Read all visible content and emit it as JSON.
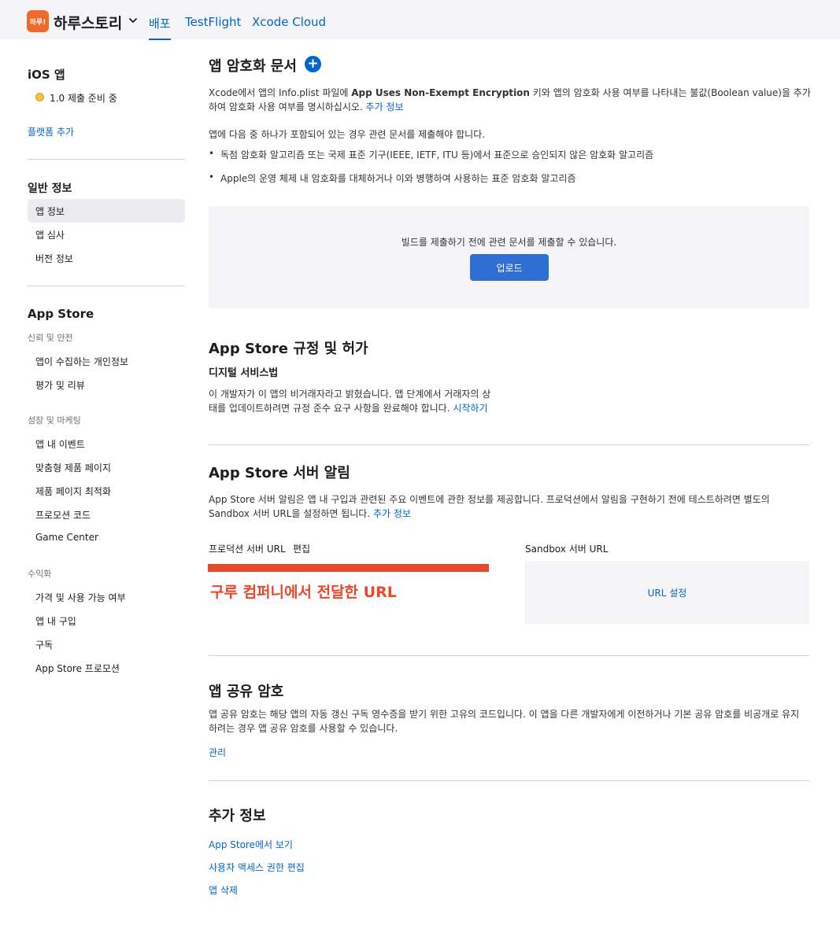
{
  "topbar": {
    "app_icon_text": "하루!",
    "app_name": "하루스토리",
    "tabs": [
      {
        "label": "배포",
        "active": true
      },
      {
        "label": "TestFlight",
        "active": false
      },
      {
        "label": "Xcode Cloud",
        "active": false
      }
    ],
    "accent_color": "#0066cc"
  },
  "sidebar": {
    "platform_title": "iOS 앱",
    "version_status": "1.0 제출 준비 중",
    "add_platform": "플랫폼 추가",
    "general_title": "일반 정보",
    "general_items": [
      "앱 정보",
      "앱 심사",
      "버전 정보"
    ],
    "store_title": "App Store",
    "trust_sub": "신뢰 및 안전",
    "trust_items": [
      "앱이 수집하는 개인정보",
      "평가 및 리뷰"
    ],
    "growth_sub": "성장 및 마케팅",
    "growth_items": [
      "앱 내 이벤트",
      "맞춤형 제품 페이지",
      "제품 페이지 최적화",
      "프로모션 코드",
      "Game Center"
    ],
    "monet_sub": "수익화",
    "monet_items": [
      "가격 및 사용 가능 여부",
      "앱 내 구입",
      "구독",
      "App Store 프로모션"
    ]
  },
  "encryption": {
    "title": "앱 암호화 문서",
    "desc_1": "Xcode에서 앱의 Info.plist 파일에 ",
    "desc_key": "App Uses Non-Exempt Encryption",
    "desc_2": " 키와 앱의 암호화 사용 여부를 나타내는 불값(Boolean value)을 추가",
    "desc_3": "하여 암호화 사용 여부를 명시하십시오. ",
    "more_info": "추가 정보",
    "intro": "앱에 다음 중 하나가 포함되어 있는 경우 관련 문서를 제출해야 합니다.",
    "bullets": [
      "독점 암호화 알고리즘 또는 국제 표준 기구(IEEE, IETF, ITU 등)에서 표준으로 승인되지 않은 암호화 알고리즘",
      "Apple의 운영 체제 내 암호화를 대체하거나 이와 병행하여 사용하는 표준 암호화 알고리즘"
    ],
    "upload_text": "빌드를 제출하기 전에 관련 문서를 제출할 수 있습니다.",
    "upload_button": "업로드"
  },
  "regulations": {
    "title": "App Store 규정 및 허가",
    "subtitle": "디지털 서비스법",
    "line_1": "이 개발자가 이 앱의 비거래자라고 밝혔습니다. 앱 단계에서 거래자의 상",
    "line_2": "태를 업데이트하려면 규정 준수 요구 사항을 완료해야 합니다. ",
    "start_link": "시작하기"
  },
  "server_notifications": {
    "title": "App Store 서버 알림",
    "line_1": "App Store 서버 알림은 앱 내 구입과 관련된 주요 이벤트에 관한 정보를 제공합니다. 프로덕션에서 알림을 구현하기 전에 테스트하려면 별도의",
    "line_2": "Sandbox 서버 URL을 설정하면 됩니다. ",
    "more_info": "추가 정보",
    "production_label": "프로덕션 서버 URL",
    "edit_link": "편집",
    "annotation": "구루 컴퍼니에서 전달한 URL",
    "sandbox_label": "Sandbox 서버 URL",
    "sandbox_link": "URL 설정"
  },
  "shared_secret": {
    "title": "앱 공유 암호",
    "line_1": "앱 공유 암호는 해당 앱의 자동 갱신 구독 영수증을 받기 위한 고유의 코드입니다. 이 앱을 다른 개발자에게 이전하거나 기본 공유 암호를 비공개로 유지",
    "line_2": "하려는 경우 앱 공유 암호를 사용할 수 있습니다.",
    "manage_link": "관리"
  },
  "additional": {
    "title": "추가 정보",
    "links": [
      "App Store에서 보기",
      "사용자 액세스 권한 편집",
      "앱 삭제"
    ]
  }
}
